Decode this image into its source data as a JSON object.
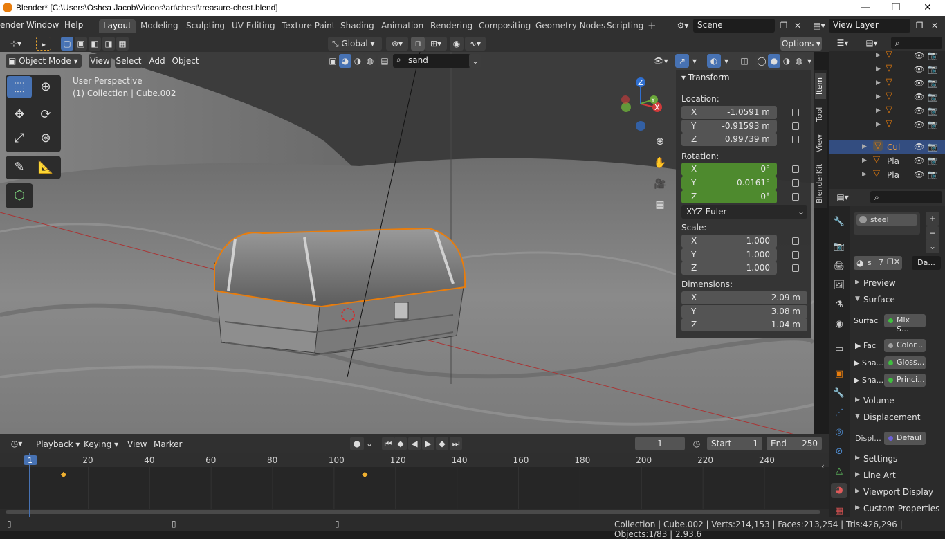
{
  "titlebar": {
    "title": "Blender* [C:\\Users\\Oshea Jacob\\Videos\\art\\chest\\treasure-chest.blend]",
    "minimize": "—",
    "maximize": "❐",
    "close": "✕"
  },
  "menubar": {
    "items": [
      "ender",
      "Window",
      "Help"
    ],
    "workspaces": [
      "Layout",
      "Modeling",
      "Sculpting",
      "UV Editing",
      "Texture Paint",
      "Shading",
      "Animation",
      "Rendering",
      "Compositing",
      "Geometry Nodes",
      "Scripting"
    ],
    "active_workspace": "Layout",
    "add_workspace": "+",
    "scene": "Scene",
    "view_layer": "View Layer"
  },
  "header3d": {
    "transform_orientation": "Global",
    "options": "Options",
    "mode": "Object Mode",
    "menus": [
      "View",
      "Select",
      "Add",
      "Object"
    ],
    "search_value": "sand"
  },
  "viewport": {
    "perspective": "User Perspective",
    "collection_info": "(1) Collection | Cube.002",
    "gizmo_axes": {
      "x": "X",
      "y": "Y",
      "z": "Z"
    }
  },
  "npanel": {
    "header": "Transform",
    "location_label": "Location:",
    "location": [
      {
        "axis": "X",
        "value": "-1.0591 m"
      },
      {
        "axis": "Y",
        "value": "-0.91593 m"
      },
      {
        "axis": "Z",
        "value": "0.99739 m"
      }
    ],
    "rotation_label": "Rotation:",
    "rotation": [
      {
        "axis": "X",
        "value": "0°"
      },
      {
        "axis": "Y",
        "value": "-0.0161°"
      },
      {
        "axis": "Z",
        "value": "0°"
      }
    ],
    "rotation_mode": "XYZ Euler",
    "scale_label": "Scale:",
    "scale": [
      {
        "axis": "X",
        "value": "1.000"
      },
      {
        "axis": "Y",
        "value": "1.000"
      },
      {
        "axis": "Z",
        "value": "1.000"
      }
    ],
    "dimensions_label": "Dimensions:",
    "dimensions": [
      {
        "axis": "X",
        "value": "2.09 m"
      },
      {
        "axis": "Y",
        "value": "3.08 m"
      },
      {
        "axis": "Z",
        "value": "1.04 m"
      }
    ],
    "tabs": [
      "Item",
      "Tool",
      "View",
      "BlenderKit"
    ]
  },
  "outliner": {
    "rows": [
      {
        "name": "",
        "selected": false
      },
      {
        "name": "",
        "selected": false
      },
      {
        "name": "",
        "selected": false
      },
      {
        "name": "",
        "selected": false
      },
      {
        "name": "",
        "selected": false
      },
      {
        "name": "",
        "selected": false
      },
      {
        "name": "Cul",
        "selected": true
      },
      {
        "name": "Pla",
        "selected": false
      },
      {
        "name": "Pla",
        "selected": false
      }
    ]
  },
  "properties": {
    "material_name": "steel",
    "slot_short": "s",
    "users": "7",
    "data_dropdown": "Da...",
    "sections": {
      "preview": "Preview",
      "surface": "Surface",
      "volume": "Volume",
      "displacement": "Displacement",
      "settings": "Settings",
      "line_art": "Line Art",
      "viewport_display": "Viewport Display",
      "custom_properties": "Custom Properties"
    },
    "surface_label": "Surfac",
    "surface_value": "Mix S...",
    "fac_label": "Fac",
    "fac_value": "Color...",
    "shader1_label": "Sha...",
    "shader1_value": "Gloss...",
    "shader2_label": "Sha...",
    "shader2_value": "Princi...",
    "displ_label": "Displ...",
    "displ_value": "Defaul"
  },
  "timeline": {
    "menus": [
      "Playback",
      "Keying",
      "View",
      "Marker"
    ],
    "current_frame": "1",
    "start_label": "Start",
    "start": "1",
    "end_label": "End",
    "end": "250",
    "ticks": [
      "1",
      "20",
      "40",
      "60",
      "80",
      "100",
      "120",
      "140",
      "160",
      "180",
      "200",
      "220",
      "240"
    ],
    "keyframes": [
      12,
      110
    ]
  },
  "statusbar": {
    "text": "Collection | Cube.002 | Verts:214,153 | Faces:213,254 | Tris:426,296 | Objects:1/83 | 2.93.6"
  },
  "colors": {
    "accent": "#4772b3",
    "selection_orange": "#e87d0d",
    "green_field": "#4e8a2e"
  }
}
